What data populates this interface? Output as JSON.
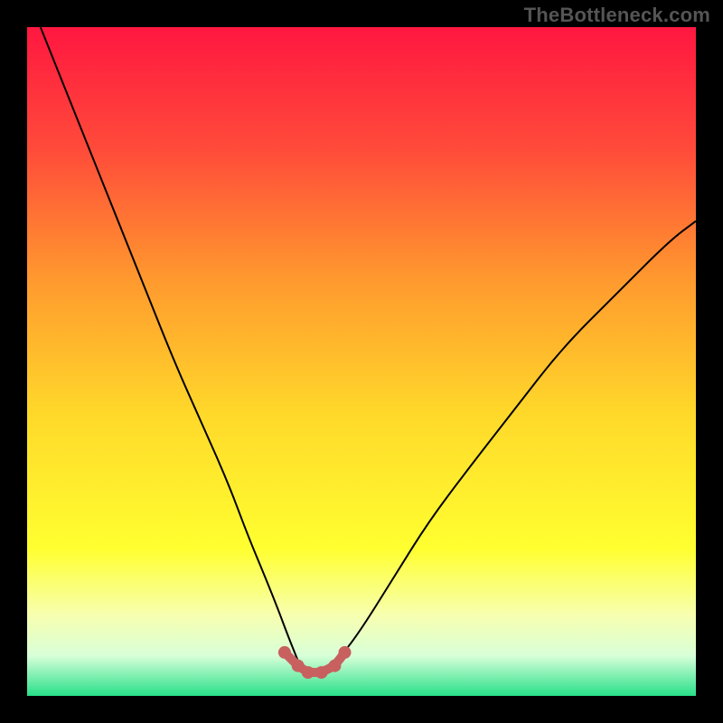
{
  "watermark": "TheBottleneck.com",
  "chart_data": {
    "type": "line",
    "title": "",
    "xlabel": "",
    "ylabel": "",
    "xlim": [
      0,
      100
    ],
    "ylim": [
      0,
      100
    ],
    "grid": false,
    "legend": false,
    "background_gradient": {
      "stops": [
        {
          "offset": 0.0,
          "color": "#ff1740"
        },
        {
          "offset": 0.18,
          "color": "#ff4a3a"
        },
        {
          "offset": 0.38,
          "color": "#ff9a2e"
        },
        {
          "offset": 0.58,
          "color": "#ffd92a"
        },
        {
          "offset": 0.78,
          "color": "#ffff30"
        },
        {
          "offset": 0.88,
          "color": "#f7ffb0"
        },
        {
          "offset": 0.94,
          "color": "#d8ffd8"
        },
        {
          "offset": 1.0,
          "color": "#27e089"
        }
      ]
    },
    "series": [
      {
        "name": "bottleneck-curve",
        "stroke": "#000000",
        "stroke_width": 2,
        "x": [
          2,
          6,
          10,
          14,
          18,
          22,
          26,
          30,
          33,
          35.5,
          37.5,
          39,
          40.2,
          41,
          41.5,
          42.5,
          43.5,
          45,
          47,
          50,
          55,
          60,
          66,
          73,
          80,
          88,
          96,
          100
        ],
        "y": [
          100,
          90,
          80,
          70,
          60,
          50,
          41,
          32,
          24,
          18,
          13,
          9,
          6,
          4,
          3,
          3,
          3,
          4,
          6,
          10,
          18,
          26,
          34,
          43,
          52,
          60,
          68,
          71
        ],
        "end_dot": false
      },
      {
        "name": "bottom-marker",
        "stroke": "#c86060",
        "stroke_width": 10,
        "linecap": "round",
        "x": [
          38.5,
          40.5,
          42,
          44,
          46,
          47.5
        ],
        "y": [
          6.5,
          4.5,
          3.5,
          3.5,
          4.5,
          6.5
        ],
        "end_dot": true,
        "dot_color": "#c86060",
        "dot_radius": 7
      }
    ]
  }
}
